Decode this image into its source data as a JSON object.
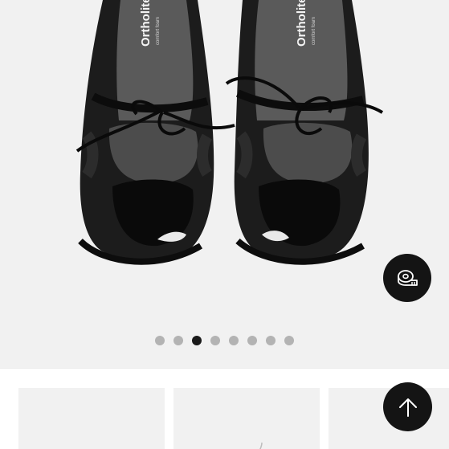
{
  "gallery": {
    "brand_text_left": "Ortholite",
    "brand_text_right": "Ortholite",
    "insole_subtext": "comfort foam",
    "slide_count": 8,
    "active_slide": 3
  },
  "buttons": {
    "measure_icon": "tape-measure-icon",
    "scroll_top_icon": "arrow-up-icon"
  },
  "related": {
    "items": [
      {
        "icon": "shoe-thumbnail"
      },
      {
        "icon": "shoe-thumbnail"
      },
      {
        "icon": "shoe-thumbnail"
      }
    ]
  },
  "colors": {
    "background": "#f1f1f1",
    "button": "#141414",
    "dot_active": "#1a1a1a",
    "dot_inactive": "#b3b3b3"
  }
}
